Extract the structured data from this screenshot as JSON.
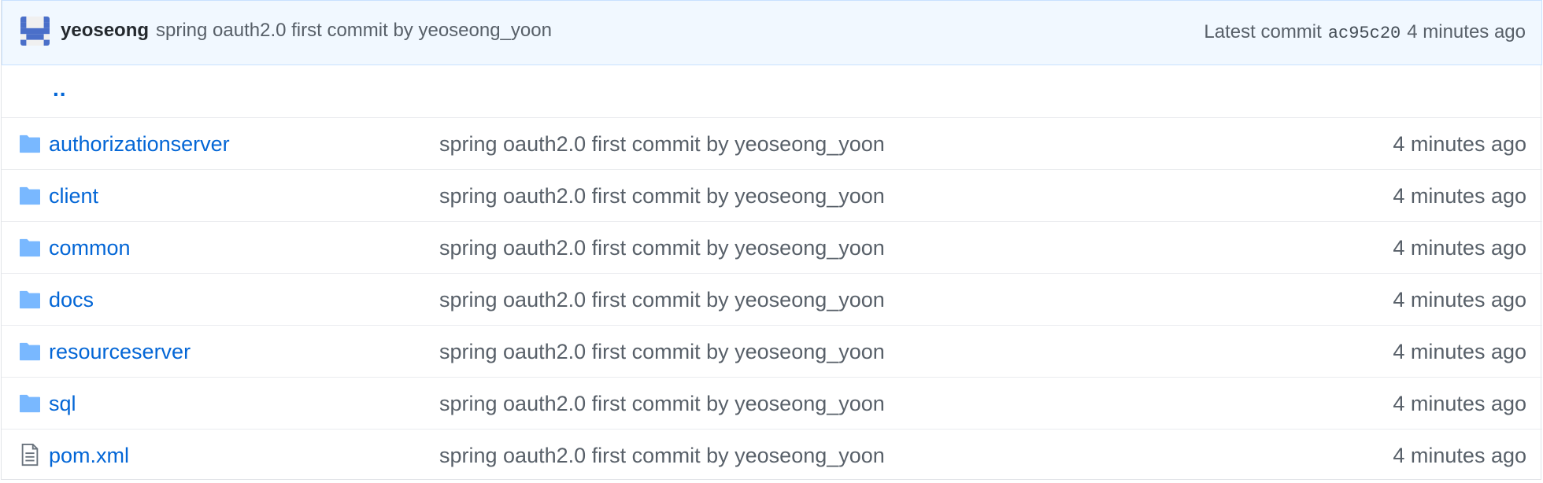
{
  "commit_header": {
    "author": "yeoseong",
    "message": "spring oauth2.0 first commit by yeoseong_yoon",
    "latest_label": "Latest commit",
    "sha": "ac95c20",
    "age": "4 minutes ago",
    "avatar_icon": "identicon-avatar",
    "avatar_color": "#4a6fc9"
  },
  "parent_link": "..",
  "colors": {
    "link": "#0366d6",
    "muted": "#586069",
    "folder_icon": "#79b8ff",
    "header_bg": "#f1f8ff"
  },
  "files": [
    {
      "name": "authorizationserver",
      "type": "folder",
      "icon": "folder-icon",
      "message": "spring oauth2.0 first commit by yeoseong_yoon",
      "age": "4 minutes ago"
    },
    {
      "name": "client",
      "type": "folder",
      "icon": "folder-icon",
      "message": "spring oauth2.0 first commit by yeoseong_yoon",
      "age": "4 minutes ago"
    },
    {
      "name": "common",
      "type": "folder",
      "icon": "folder-icon",
      "message": "spring oauth2.0 first commit by yeoseong_yoon",
      "age": "4 minutes ago"
    },
    {
      "name": "docs",
      "type": "folder",
      "icon": "folder-icon",
      "message": "spring oauth2.0 first commit by yeoseong_yoon",
      "age": "4 minutes ago"
    },
    {
      "name": "resourceserver",
      "type": "folder",
      "icon": "folder-icon",
      "message": "spring oauth2.0 first commit by yeoseong_yoon",
      "age": "4 minutes ago"
    },
    {
      "name": "sql",
      "type": "folder",
      "icon": "folder-icon",
      "message": "spring oauth2.0 first commit by yeoseong_yoon",
      "age": "4 minutes ago"
    },
    {
      "name": "pom.xml",
      "type": "file",
      "icon": "file-icon",
      "message": "spring oauth2.0 first commit by yeoseong_yoon",
      "age": "4 minutes ago"
    }
  ]
}
